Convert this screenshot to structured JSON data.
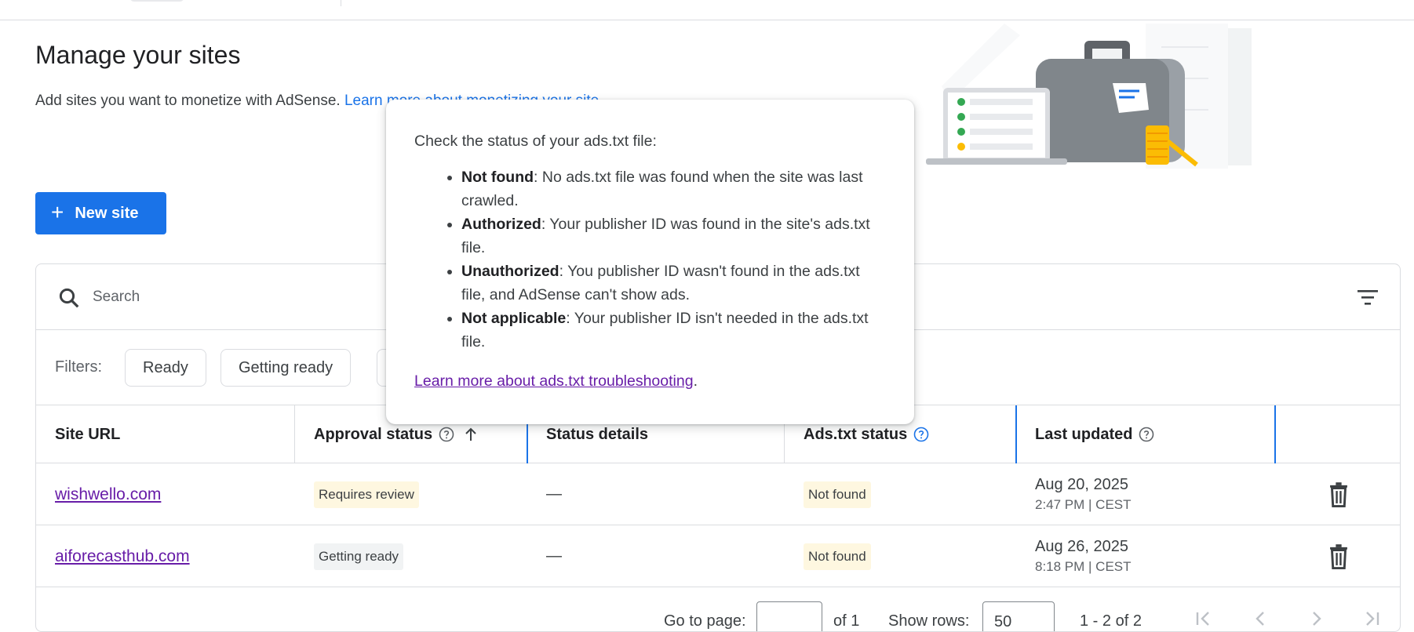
{
  "page": {
    "title": "Manage your sites",
    "subtitle": "Add sites you want to monetize with AdSense.",
    "subtitle_link": "Learn more about monetizing your site"
  },
  "toolbar": {
    "new_site_label": "New site"
  },
  "search": {
    "placeholder": "Search"
  },
  "filters": {
    "label": "Filters:",
    "chips": [
      "Ready",
      "Getting ready"
    ]
  },
  "table": {
    "headers": {
      "site_url": "Site URL",
      "approval_status": "Approval status",
      "status_details": "Status details",
      "ads_txt_status": "Ads.txt status",
      "last_updated": "Last updated"
    },
    "rows": [
      {
        "site": "wishwello.com",
        "approval": "Requires review",
        "details": "—",
        "ads_txt": "Not found",
        "date": "Aug 20, 2025",
        "time": "2:47 PM | CEST"
      },
      {
        "site": "aiforecasthub.com",
        "approval": "Getting ready",
        "details": "—",
        "ads_txt": "Not found",
        "date": "Aug 26, 2025",
        "time": "8:18 PM | CEST"
      }
    ]
  },
  "pagination": {
    "goto_label": "Go to page:",
    "of_label": "of 1",
    "rows_label": "Show rows:",
    "rows_value": "50",
    "range": "1 - 2 of 2"
  },
  "tooltip": {
    "intro": "Check the status of your ads.txt file:",
    "items": [
      {
        "term": "Not found",
        "desc": ": No ads.txt file was found when the site was last crawled."
      },
      {
        "term": "Authorized",
        "desc": ": Your publisher ID was found in the site's ads.txt file."
      },
      {
        "term": "Unauthorized",
        "desc": ": You publisher ID wasn't found in the ads.txt file, and AdSense can't show ads."
      },
      {
        "term": "Not applicable",
        "desc": ": Your publisher ID isn't needed in the ads.txt file."
      }
    ],
    "link": "Learn more about ads.txt troubleshooting",
    "link_suffix": "."
  },
  "colors": {
    "primary": "#1a73e8",
    "visited_link": "#681da8",
    "warn_badge_bg": "#fef7e0",
    "neutral_badge_bg": "#f1f3f4"
  }
}
